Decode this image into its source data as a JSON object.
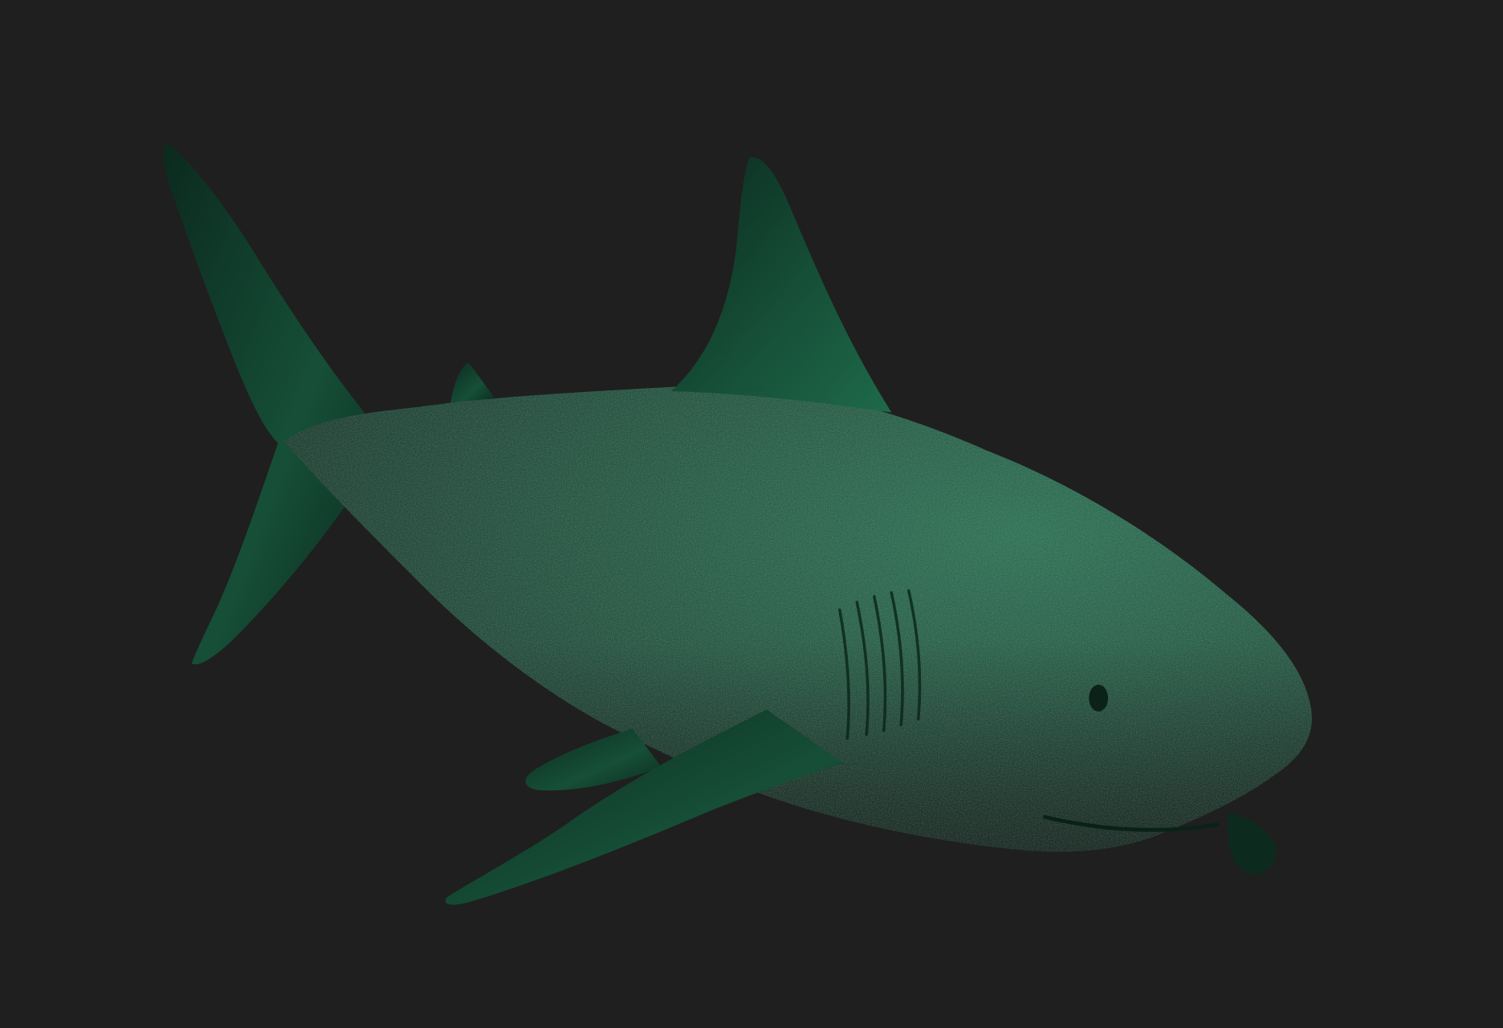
{
  "scene": {
    "subject": "shark-3d-render",
    "colors": {
      "background": "#1f1f1f",
      "skin_light": "#1e6a4a",
      "skin_mid": "#164f38",
      "skin_dark": "#0b2a1e",
      "shadow": "#0a1410",
      "eye": "#0c2219"
    }
  }
}
